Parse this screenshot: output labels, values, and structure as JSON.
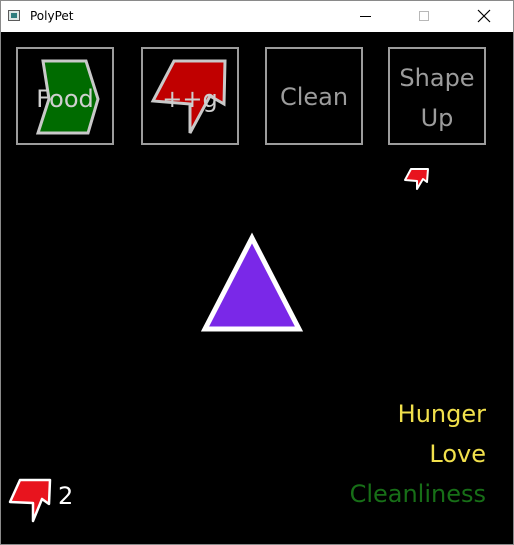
{
  "window": {
    "title": "PolyPet",
    "controls": [
      "minimize",
      "maximize",
      "close"
    ]
  },
  "actions": [
    {
      "id": "food",
      "label": "Food",
      "icon": "green-hexagon-icon",
      "icon_color": "#006b00"
    },
    {
      "id": "boost",
      "label": "++g",
      "icon": "red-arrow-icon",
      "icon_color": "#c00000"
    },
    {
      "id": "clean",
      "label": "Clean"
    },
    {
      "id": "shape",
      "label": "Shape Up",
      "label_lines": [
        "Shape",
        "Up"
      ]
    }
  ],
  "pet": {
    "shape": "triangle",
    "fill": "#7a28e8",
    "outline": "#ffffff"
  },
  "stats": {
    "hunger": {
      "label": "Hunger",
      "color": "#f1e04c"
    },
    "love": {
      "label": "Love",
      "color": "#f1e04c"
    },
    "cleanliness": {
      "label": "Cleanliness",
      "color": "#176f17"
    }
  },
  "currency": {
    "icon": "red-arrow-icon",
    "count": "2"
  },
  "colors": {
    "background": "#000000",
    "tile_border": "#9c9c9c",
    "arrow_red": "#e8141e"
  }
}
